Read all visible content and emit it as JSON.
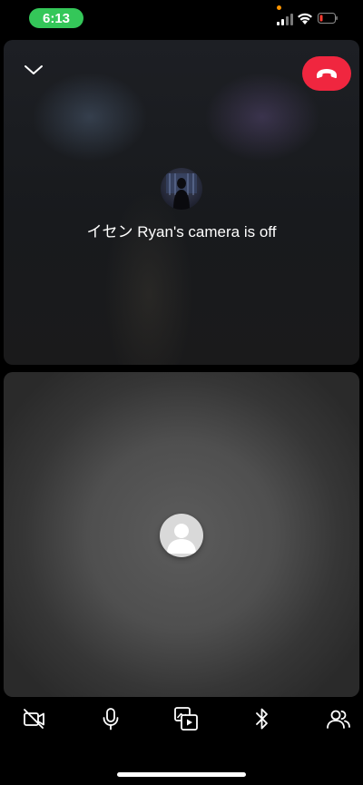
{
  "status_bar": {
    "time": "6:13",
    "icons": [
      "cellular-signal-icon",
      "wifi-icon",
      "battery-low-icon"
    ],
    "colors": {
      "time_pill": "#34c759",
      "battery_low": "#ff3b30",
      "privacy_dot": "#ff9500"
    }
  },
  "call": {
    "remote_tile": {
      "message": "イセン Ryan's camera is off",
      "collapse_icon": "chevron-down-icon",
      "end_call_icon": "end-call-icon",
      "end_call_color": "#f0263f"
    },
    "self_tile": {
      "avatar_icon": "default-user-avatar-icon"
    }
  },
  "toolbar": {
    "items": [
      {
        "icon": "camera-off-icon"
      },
      {
        "icon": "microphone-icon"
      },
      {
        "icon": "media-share-icon"
      },
      {
        "icon": "bluetooth-icon"
      },
      {
        "icon": "participants-icon"
      }
    ]
  }
}
